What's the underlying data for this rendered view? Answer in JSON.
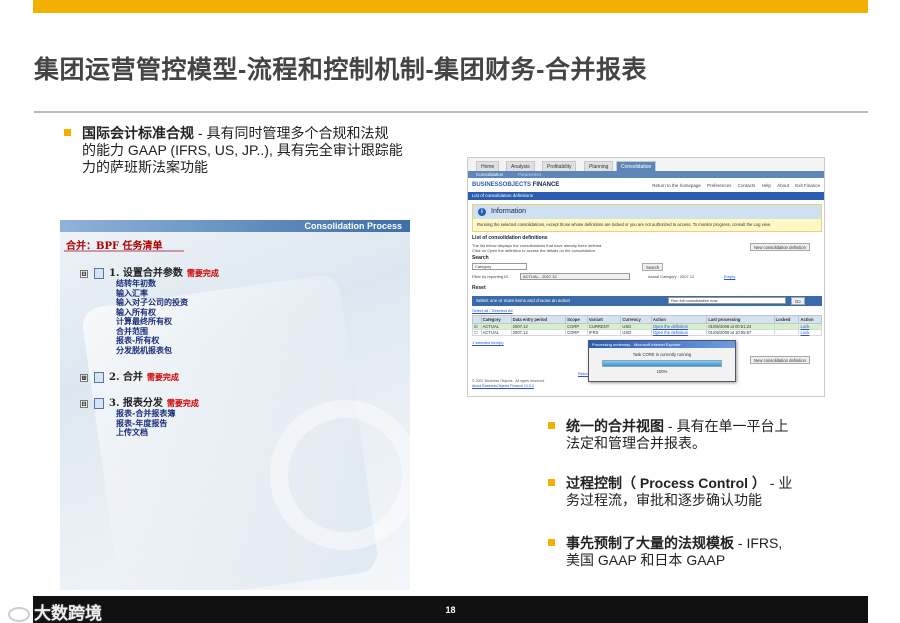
{
  "slide": {
    "title": "集团运营管控模型-流程和控制机制-集团财务-合并报表",
    "page_number": "18",
    "watermark": "大数跨境"
  },
  "bullets": {
    "b1_bold": "国际会计标准合规",
    "b1_l1": " - 具有同时管理多个合规和法规",
    "b1_l2": "的能力 GAAP (IFRS, US, JP..), 具有完全审计跟踪能",
    "b1_l3": "力的萨班斯法案功能",
    "b2_bold": "统一的合并视图",
    "b2_l1": " - 具有在单一平台上",
    "b2_l2": "法定和管理合并报表。",
    "b3_bold": "过程控制（ Process Control ）",
    "b3_l1": " - 业",
    "b3_l2": "务过程流，审批和逐步确认功能",
    "b4_bold": "事先预制了大量的法规模板",
    "b4_l1": " - IFRS,",
    "b4_l2": "美国 GAAP 和日本 GAAP"
  },
  "bpf": {
    "header": "Consolidation Process",
    "title": "合并：BPF 任务清单",
    "step1_label": "1. 设置合并参数",
    "step1_status": "需要完成",
    "step1_items": [
      "结转年初数",
      "输入汇率",
      "输入对子公司的投资",
      "输入所有权",
      "计算最终所有权",
      "合并范围",
      "报表-所有权",
      "分发脱机报表包"
    ],
    "step2_label": "2. 合并",
    "step2_status": "需要完成",
    "step3_label": "3. 报表分发",
    "step3_status": "需要完成",
    "step3_items": [
      "报表-合并报表簿",
      "报表-年度报告",
      "上传文档"
    ],
    "toggle_open": "⊟",
    "toggle_closed": "⊞"
  },
  "app": {
    "tabs": [
      "Home",
      "Analysis",
      "Profitability",
      "Planning",
      "Consolidation"
    ],
    "subtabs": [
      "Consolidation",
      "Parameters"
    ],
    "logo_prefix": "BUSINESSOBJECTS",
    "logo_suffix": " FINANCE",
    "toplinks": [
      "Return to the homepage",
      "Preferences",
      "Contacts",
      "Help",
      "About",
      "Exit Finance"
    ],
    "strip": "List of consolidation definitions",
    "info_title": "Information",
    "info_msg": "Running the selected consolidations, except those whose definitions are locked or you are not authorized to access. To monitor progress, consult the Log view.",
    "list_title": "List of consolidation definitions",
    "list_help1": "The list below displays the consolidations that have already been defined.",
    "list_help2": "Click on Open the definition to access the details on the consolidation.",
    "new_def_btn": "New consolidation definition",
    "search_label": "Search",
    "search_field": "Category",
    "search_btn": "Search",
    "filter_label": "Filter by reporting ID",
    "filter_value": "ACTUAL - 2007.12",
    "actual_cat": "Actual Category : 2007.12",
    "empty_link": "Empty",
    "reset_label": "Reset",
    "result_bar": "Select one or more items and choose an action",
    "action_select": "Run full consolidation now",
    "go_btn": "Go",
    "select_links": "Select all  /  Deselect All",
    "columns": [
      "",
      "Category",
      "Data entry period",
      "Scope",
      "Variant",
      "Currency",
      "Action",
      "Last processing",
      "Locked",
      "Action"
    ],
    "rows": [
      [
        "☑",
        "ACTUAL",
        "2007.12",
        "CORP",
        "CURRENT",
        "USD",
        "Open the definition",
        "01/05/2008 at 00:51:24",
        "",
        "Lock"
      ],
      [
        "☐",
        "ACTUAL",
        "2007.12",
        "CORP",
        "IFRS",
        "USD",
        "Open the definition",
        "01/05/2008 at 10:55:57",
        "",
        "Lock"
      ]
    ],
    "selected_link": "1 selected item(s)",
    "progress_title": "Processing underway - Microsoft Internet Explorer",
    "progress_msg": "Task CORE is currently running",
    "progress_pct": "100%",
    "progress_value": 1.0,
    "new_def_btn2": "New consolidation definition",
    "return_link": "Return to the top",
    "copyright1": "© 2007 Business Objects . All rights reserved.",
    "copyright2": "About BusinessObjects Finance 10.0.0"
  },
  "colors": {
    "accent": "#f2b000",
    "bar_dark": "#111111",
    "bo_blue": "#2a5db0"
  }
}
